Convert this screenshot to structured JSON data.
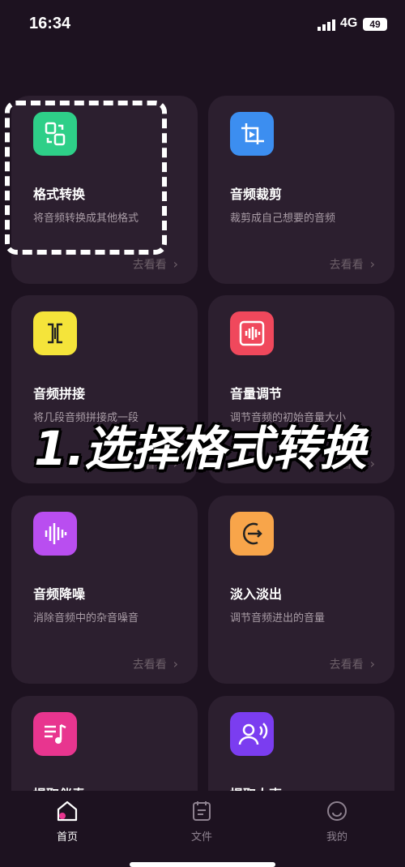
{
  "status_bar": {
    "time": "16:34",
    "network": "4G",
    "battery": "49"
  },
  "cards": [
    {
      "title": "格式转换",
      "desc": "将音频转换成其他格式",
      "link": "去看看",
      "icon": "format-convert-icon",
      "color": "#2ecf88"
    },
    {
      "title": "音频裁剪",
      "desc": "裁剪成自己想要的音频",
      "link": "去看看",
      "icon": "crop-icon",
      "color": "#3c8ef0"
    },
    {
      "title": "音频拼接",
      "desc": "将几段音频拼接成一段",
      "link": "去看看",
      "icon": "join-icon",
      "color": "#f5e43a"
    },
    {
      "title": "音量调节",
      "desc": "调节音频的初始音量大小",
      "link": "去看看",
      "icon": "volume-waveform-icon",
      "color": "#f0485c"
    },
    {
      "title": "音频降噪",
      "desc": "消除音频中的杂音噪音",
      "link": "去看看",
      "icon": "denoise-waveform-icon",
      "color": "#b94ef0"
    },
    {
      "title": "淡入淡出",
      "desc": "调节音频进出的音量",
      "link": "去看看",
      "icon": "fade-icon",
      "color": "#f8a54a"
    },
    {
      "title": "提取伴奏",
      "icon": "music-list-icon",
      "color": "#e8358f"
    },
    {
      "title": "提取人声",
      "icon": "voice-icon",
      "color": "#7b3df0"
    }
  ],
  "caption": "1.选择格式转换",
  "tabs": [
    {
      "label": "首页",
      "icon": "home-icon",
      "active": true
    },
    {
      "label": "文件",
      "icon": "file-icon",
      "active": false
    },
    {
      "label": "我的",
      "icon": "profile-icon",
      "active": false
    }
  ]
}
